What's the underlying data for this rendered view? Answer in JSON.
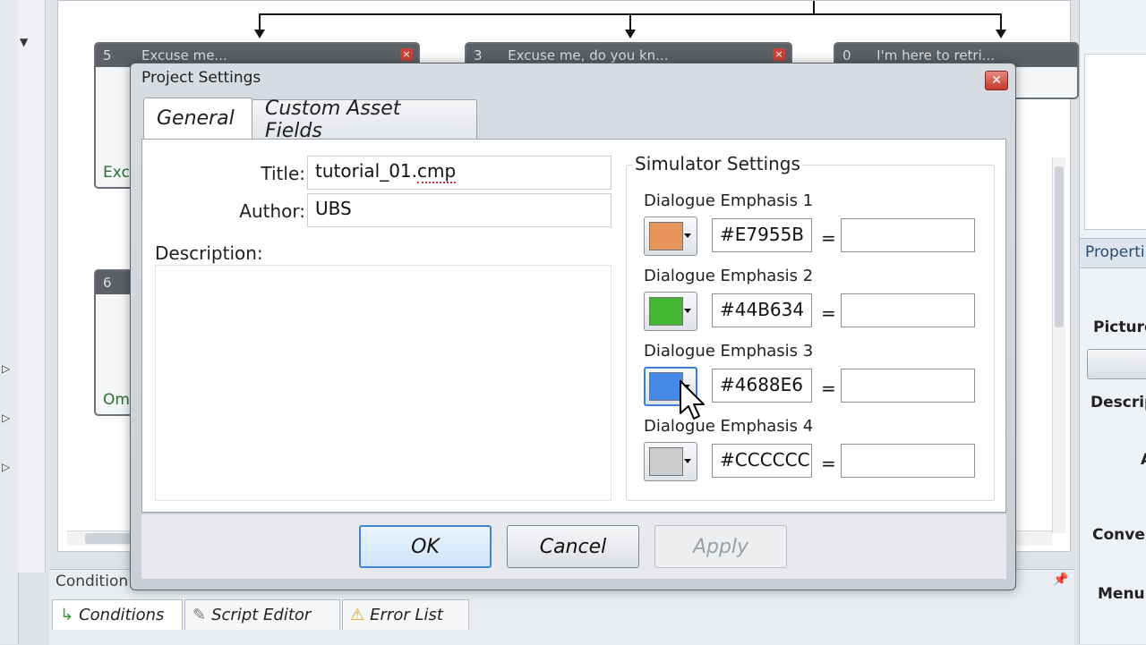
{
  "background": {
    "nodes": [
      {
        "number": "5",
        "title": "Excuse me...",
        "footer": "Exc"
      },
      {
        "number": "3",
        "title": "Excuse me, do you kn...",
        "footer": ""
      },
      {
        "number": "0",
        "title": "I'm here to retri...",
        "footer": ""
      },
      {
        "number": "6",
        "title": "",
        "footer": "Om"
      }
    ],
    "node_close_glyph": "×",
    "bottom_panel_title": "Condition",
    "bottom_tabs": [
      {
        "label": "Conditions",
        "icon": "conditions-icon"
      },
      {
        "label": "Script Editor",
        "icon": "script-icon"
      },
      {
        "label": "Error List",
        "icon": "warning-icon"
      }
    ],
    "right_panel": {
      "header": "Properti",
      "labels": [
        "Picture",
        "Descrip",
        "A",
        "Conver",
        "Menu"
      ]
    }
  },
  "dialog": {
    "title": "Project Settings",
    "close_glyph": "✕",
    "tabs": [
      {
        "label": "General",
        "active": true
      },
      {
        "label": "Custom Asset Fields",
        "active": false
      }
    ],
    "general": {
      "title_label": "Title:",
      "title_value_base": "tutorial_01.",
      "title_value_ext": "cmp",
      "author_label": "Author:",
      "author_value": "UBS",
      "description_label": "Description:",
      "description_value": ""
    },
    "simulator": {
      "group_label": "Simulator Settings",
      "emphases": [
        {
          "label": "Dialogue Emphasis 1",
          "hex": "#E7955B",
          "color": "#E7955B",
          "value": ""
        },
        {
          "label": "Dialogue Emphasis 2",
          "hex": "#44B634",
          "color": "#44B634",
          "value": ""
        },
        {
          "label": "Dialogue Emphasis 3",
          "hex": "#4688E6",
          "color": "#4688E6",
          "value": ""
        },
        {
          "label": "Dialogue Emphasis 4",
          "hex": "#CCCCCC",
          "color": "#CCCCCC",
          "value": ""
        }
      ],
      "equals": "="
    },
    "buttons": {
      "ok": "OK",
      "cancel": "Cancel",
      "apply": "Apply"
    }
  }
}
